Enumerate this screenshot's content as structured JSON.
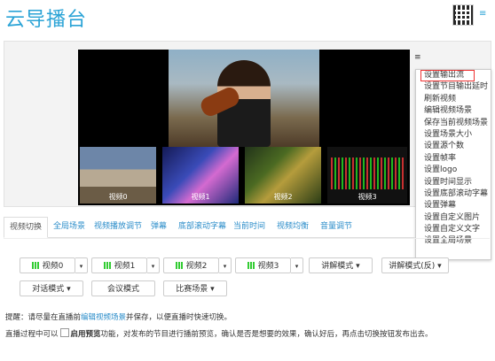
{
  "app": {
    "title": "云导播台",
    "menu_icon": "≡"
  },
  "video": {
    "thumbs": [
      {
        "label": "视频0"
      },
      {
        "label": "视频1"
      },
      {
        "label": "视频2"
      },
      {
        "label": "视频3"
      }
    ]
  },
  "context_menu": {
    "trigger": "≡",
    "items": [
      "设置输出流",
      "设置节目输出延时",
      "刷新视频",
      "编辑视频场景",
      "保存当前视频场景",
      "设置场景大小",
      "设置源个数",
      "设置帧率",
      "设置logo",
      "设置时间显示",
      "设置底部滚动字幕",
      "设置弹幕",
      "设置自定义图片",
      "设置自定义文字",
      "设置全局场景"
    ]
  },
  "tabs": [
    "视频切换",
    "全局场景",
    "视频播放调节",
    "弹幕",
    "底部滚动字幕",
    "当前时间",
    "视频均衡",
    "音量调节"
  ],
  "buttons": {
    "sources": [
      "视频0",
      "视频1",
      "视频2",
      "视频3"
    ],
    "mode_narrate": "讲解模式 ▾",
    "mode_narrate_rev": "讲解模式(反) ▾",
    "mode_dialog": "对话模式 ▾",
    "mode_meeting": "会议模式",
    "mode_match": "比赛场景 ▾",
    "caret": "▾"
  },
  "tips": {
    "line1_prefix": "提醒：请尽量在直播前",
    "line1_link": "编辑视频场景",
    "line1_suffix": "并保存，以便直播时快速切换。",
    "line2_prefix": "直播过程中可以",
    "line2_bold": "启用预览",
    "line2_suffix": "功能，对发布的节目进行播前预览，确认是否是想要的效果，确认好后，再点击切换按钮发布出去。"
  }
}
